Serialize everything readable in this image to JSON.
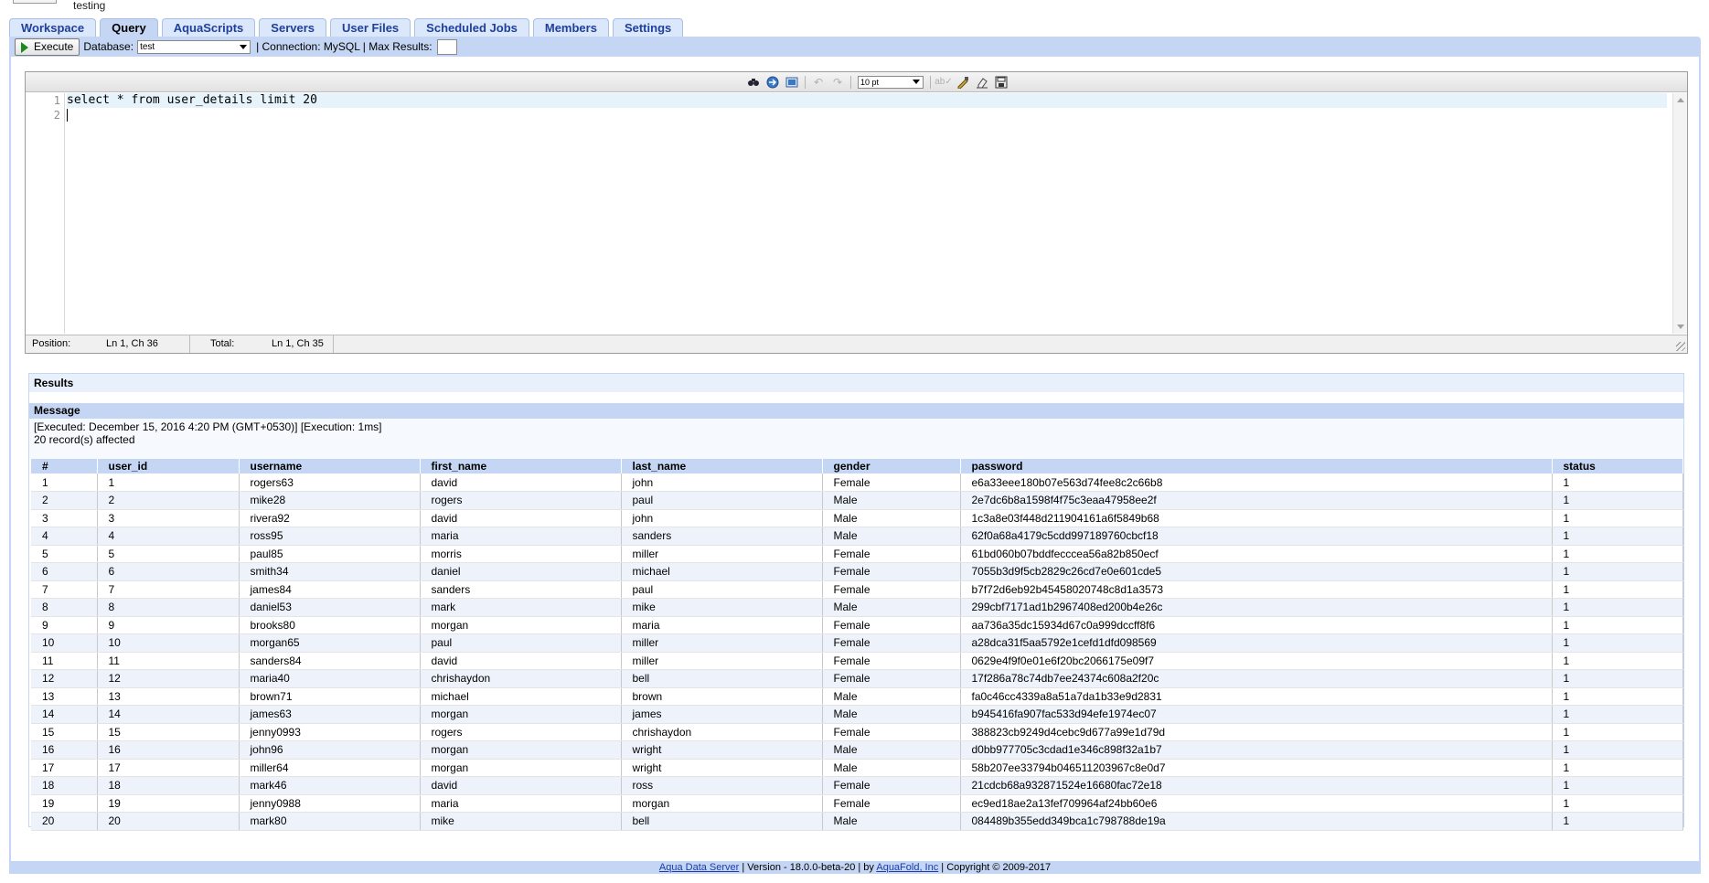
{
  "header": {
    "label": "testing"
  },
  "tabs": [
    {
      "label": "Workspace",
      "active": false
    },
    {
      "label": "Query",
      "active": true
    },
    {
      "label": "AquaScripts",
      "active": false
    },
    {
      "label": "Servers",
      "active": false
    },
    {
      "label": "User Files",
      "active": false
    },
    {
      "label": "Scheduled Jobs",
      "active": false
    },
    {
      "label": "Members",
      "active": false
    },
    {
      "label": "Settings",
      "active": false
    }
  ],
  "toolbar": {
    "execute_label": "Execute",
    "database_label": "Database:",
    "database_value": "test",
    "connection_text": "| Connection: MySQL | Max Results:",
    "max_results_value": ""
  },
  "editor": {
    "font_size_value": "10 pt",
    "line_numbers": [
      "1",
      "2"
    ],
    "lines": [
      "select * from user_details limit 20",
      ""
    ],
    "position_label": "Position:",
    "position_value": "Ln 1, Ch 36",
    "total_label": "Total:",
    "total_value": "Ln 1, Ch 35"
  },
  "results": {
    "title": "Results",
    "message_title": "Message",
    "message_line1": "[Executed: December 15, 2016 4:20 PM (GMT+0530)] [Execution: 1ms]",
    "message_line2": "20 record(s) affected",
    "columns": [
      "#",
      "user_id",
      "username",
      "first_name",
      "last_name",
      "gender",
      "password",
      "status"
    ],
    "rows": [
      [
        "1",
        "1",
        "rogers63",
        "david",
        "john",
        "Female",
        "e6a33eee180b07e563d74fee8c2c66b8",
        "1"
      ],
      [
        "2",
        "2",
        "mike28",
        "rogers",
        "paul",
        "Male",
        "2e7dc6b8a1598f4f75c3eaa47958ee2f",
        "1"
      ],
      [
        "3",
        "3",
        "rivera92",
        "david",
        "john",
        "Male",
        "1c3a8e03f448d211904161a6f5849b68",
        "1"
      ],
      [
        "4",
        "4",
        "ross95",
        "maria",
        "sanders",
        "Male",
        "62f0a68a4179c5cdd997189760cbcf18",
        "1"
      ],
      [
        "5",
        "5",
        "paul85",
        "morris",
        "miller",
        "Female",
        "61bd060b07bddfecccea56a82b850ecf",
        "1"
      ],
      [
        "6",
        "6",
        "smith34",
        "daniel",
        "michael",
        "Female",
        "7055b3d9f5cb2829c26cd7e0e601cde5",
        "1"
      ],
      [
        "7",
        "7",
        "james84",
        "sanders",
        "paul",
        "Female",
        "b7f72d6eb92b45458020748c8d1a3573",
        "1"
      ],
      [
        "8",
        "8",
        "daniel53",
        "mark",
        "mike",
        "Male",
        "299cbf7171ad1b2967408ed200b4e26c",
        "1"
      ],
      [
        "9",
        "9",
        "brooks80",
        "morgan",
        "maria",
        "Female",
        "aa736a35dc15934d67c0a999dccff8f6",
        "1"
      ],
      [
        "10",
        "10",
        "morgan65",
        "paul",
        "miller",
        "Female",
        "a28dca31f5aa5792e1cefd1dfd098569",
        "1"
      ],
      [
        "11",
        "11",
        "sanders84",
        "david",
        "miller",
        "Female",
        "0629e4f9f0e01e6f20bc2066175e09f7",
        "1"
      ],
      [
        "12",
        "12",
        "maria40",
        "chrishaydon",
        "bell",
        "Female",
        "17f286a78c74db7ee24374c608a2f20c",
        "1"
      ],
      [
        "13",
        "13",
        "brown71",
        "michael",
        "brown",
        "Male",
        "fa0c46cc4339a8a51a7da1b33e9d2831",
        "1"
      ],
      [
        "14",
        "14",
        "james63",
        "morgan",
        "james",
        "Male",
        "b945416fa907fac533d94efe1974ec07",
        "1"
      ],
      [
        "15",
        "15",
        "jenny0993",
        "rogers",
        "chrishaydon",
        "Female",
        "388823cb9249d4cebc9d677a99e1d79d",
        "1"
      ],
      [
        "16",
        "16",
        "john96",
        "morgan",
        "wright",
        "Male",
        "d0bb977705c3cdad1e346c898f32a1b7",
        "1"
      ],
      [
        "17",
        "17",
        "miller64",
        "morgan",
        "wright",
        "Male",
        "58b207ee33794b046511203967c8e0d7",
        "1"
      ],
      [
        "18",
        "18",
        "mark46",
        "david",
        "ross",
        "Female",
        "21cdcb68a932871524e16680fac72e18",
        "1"
      ],
      [
        "19",
        "19",
        "jenny0988",
        "maria",
        "morgan",
        "Female",
        "ec9ed18ae2a13fef709964af24bb60e6",
        "1"
      ],
      [
        "20",
        "20",
        "mark80",
        "mike",
        "bell",
        "Male",
        "084489b355edd349bca1c798788de19a",
        "1"
      ]
    ]
  },
  "footer": {
    "product_link": "Aqua Data Server",
    "version_text": " | Version - 18.0.0-beta-20 | by ",
    "company_link": "AquaFold, Inc",
    "copyright_text": " | Copyright © 2009-2017"
  },
  "icons": [
    "find-icon",
    "goto-icon",
    "select-all-icon",
    "undo-icon",
    "redo-icon",
    "spellcheck-icon",
    "format-icon",
    "clear-icon",
    "save-icon"
  ]
}
